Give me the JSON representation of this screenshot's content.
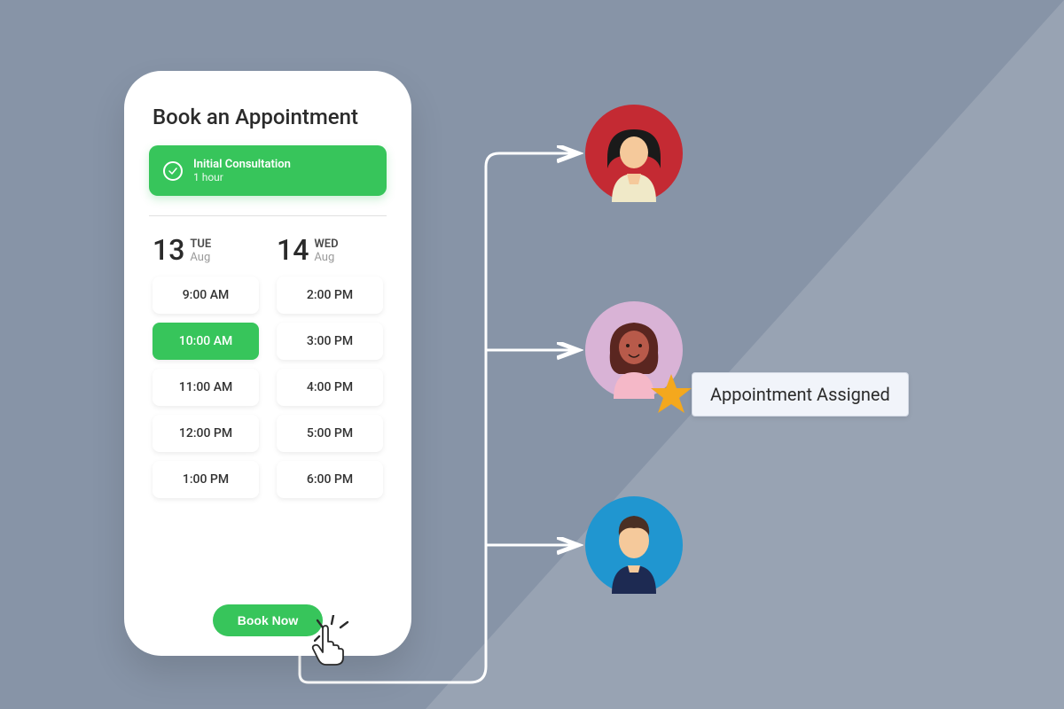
{
  "title": "Book an Appointment",
  "service": {
    "name": "Initial Consultation",
    "duration": "1 hour"
  },
  "days": [
    {
      "num": "13",
      "weekday": "TUE",
      "month": "Aug",
      "slots": [
        "9:00 AM",
        "10:00 AM",
        "11:00 AM",
        "12:00 PM",
        "1:00 PM"
      ],
      "selectedIndex": 1
    },
    {
      "num": "14",
      "weekday": "WED",
      "month": "Aug",
      "slots": [
        "2:00 PM",
        "3:00 PM",
        "4:00 PM",
        "5:00 PM",
        "6:00 PM"
      ],
      "selectedIndex": -1
    }
  ],
  "bookButton": "Book Now",
  "assignedLabel": "Appointment Assigned",
  "avatars": [
    {
      "bg": "#c42a33"
    },
    {
      "bg": "#d9b3d6"
    },
    {
      "bg": "#2096d0"
    }
  ]
}
